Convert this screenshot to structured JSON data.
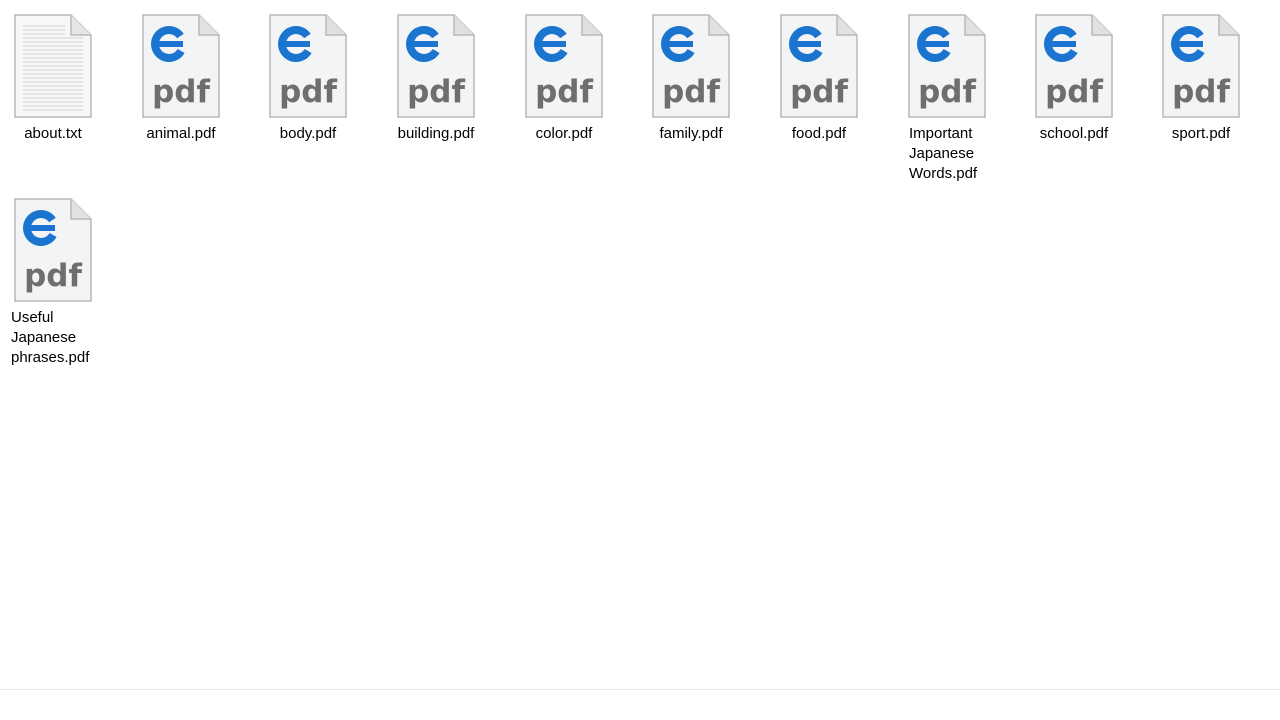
{
  "view": {
    "files": [
      {
        "name": "about.txt",
        "type": "txt",
        "icon": "text-file-icon"
      },
      {
        "name": "animal.pdf",
        "type": "pdf",
        "icon": "edge-pdf-icon"
      },
      {
        "name": "body.pdf",
        "type": "pdf",
        "icon": "edge-pdf-icon"
      },
      {
        "name": "building.pdf",
        "type": "pdf",
        "icon": "edge-pdf-icon"
      },
      {
        "name": "color.pdf",
        "type": "pdf",
        "icon": "edge-pdf-icon"
      },
      {
        "name": "family.pdf",
        "type": "pdf",
        "icon": "edge-pdf-icon"
      },
      {
        "name": "food.pdf",
        "type": "pdf",
        "icon": "edge-pdf-icon"
      },
      {
        "name": "Important Japanese Words.pdf",
        "type": "pdf",
        "icon": "edge-pdf-icon"
      },
      {
        "name": "school.pdf",
        "type": "pdf",
        "icon": "edge-pdf-icon"
      },
      {
        "name": "sport.pdf",
        "type": "pdf",
        "icon": "edge-pdf-icon"
      },
      {
        "name": "Useful Japanese phrases.pdf",
        "type": "pdf",
        "icon": "edge-pdf-icon"
      }
    ],
    "icon_text": {
      "pdf": "pdf"
    },
    "colors": {
      "edge_blue": "#1b75d0",
      "pdf_text_gray": "#6e6e6e",
      "page_fill": "#f3f4f5",
      "page_border": "#b8b8b8",
      "fold_fill": "#e1e1e1"
    }
  }
}
